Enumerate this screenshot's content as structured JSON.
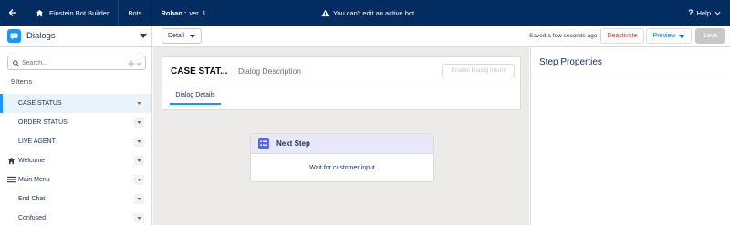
{
  "topbar": {
    "builder_label": "Einstein Bot Builder",
    "bots_label": "Bots",
    "bot_name": "Rohan :",
    "bot_version": "ver. 1",
    "warning": "You can't edit an active bot.",
    "help_label": "Help"
  },
  "sidebar": {
    "title": "Dialogs",
    "search_placeholder": "Search...",
    "count_label": "9 Items",
    "items": [
      {
        "label": "CASE STATUS",
        "icon": "",
        "selected": true
      },
      {
        "label": "ORDER STATUS",
        "icon": ""
      },
      {
        "label": "LIVE AGENT",
        "icon": ""
      },
      {
        "label": "Welcome",
        "icon": "home-icon"
      },
      {
        "label": "Main Menu",
        "icon": "menu-icon"
      },
      {
        "label": "End Chat",
        "icon": ""
      },
      {
        "label": "Confused",
        "icon": ""
      }
    ]
  },
  "toolbar": {
    "view_select": "Detail",
    "saved_status": "Saved a few seconds ago",
    "deactivate_label": "Deactivate",
    "preview_label": "Preview",
    "save_label": "Save"
  },
  "dialog": {
    "name": "CASE STAT...",
    "description_placeholder": "Dialog Description",
    "intent_button": "Enable Dialog Intent",
    "tab_label": "Dialog Details"
  },
  "step": {
    "title": "Next Step",
    "body": "Wait for customer input"
  },
  "properties": {
    "title": "Step Properties"
  },
  "colors": {
    "topbar": "#032d60",
    "accent": "#1b96ff",
    "deactivate": "#c23934",
    "step_icon": "#5867e8"
  }
}
